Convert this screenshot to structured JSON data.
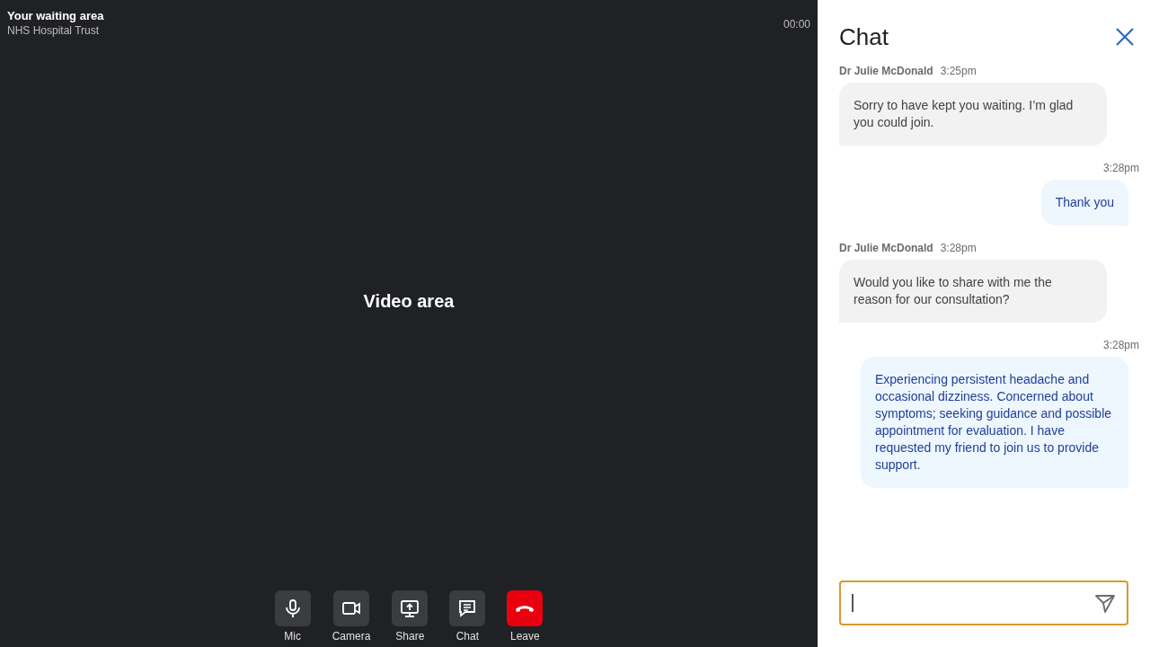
{
  "header": {
    "title": "Your waiting area",
    "subtitle": "NHS Hospital Trust",
    "timer": "00:00"
  },
  "video": {
    "label": "Video area"
  },
  "controls": [
    {
      "kind": "mic",
      "label": "Mic"
    },
    {
      "kind": "camera",
      "label": "Camera"
    },
    {
      "kind": "share",
      "label": "Share"
    },
    {
      "kind": "chat",
      "label": "Chat"
    },
    {
      "kind": "leave",
      "label": "Leave"
    }
  ],
  "chat": {
    "title": "Chat",
    "messages": [
      {
        "kind": "received",
        "sender": "Dr Julie McDonald",
        "time": "3:25pm",
        "text": "Sorry to have kept you waiting. I’m glad you could join."
      },
      {
        "kind": "sent",
        "time": "3:28pm",
        "text": "Thank you"
      },
      {
        "kind": "received",
        "sender": "Dr Julie McDonald",
        "time": "3:28pm",
        "text": "Would you like to share with me the reason for our consultation?"
      },
      {
        "kind": "sent",
        "time": "3:28pm",
        "text": "Experiencing persistent headache and occasional dizziness. Concerned about symptoms; seeking guidance and possible appointment for evaluation. I have requested my friend to join us to provide support."
      }
    ]
  }
}
